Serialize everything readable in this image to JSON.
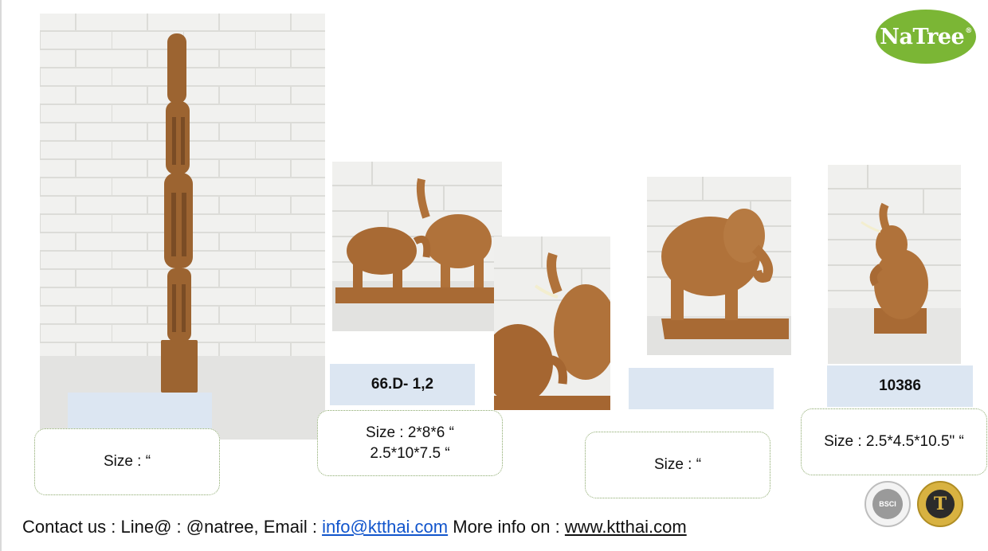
{
  "logo": {
    "text": "NaTree",
    "mark": "®"
  },
  "products": [
    {
      "code": "",
      "size": "Size : “"
    },
    {
      "code": "66.D- 1,2",
      "size_line1": "Size : 2*8*6 “",
      "size_line2": "2.5*10*7.5 “"
    },
    {
      "code": "",
      "size": "Size : “"
    },
    {
      "code": "10386",
      "size": "Size : 2.5*4.5*10.5\" “"
    }
  ],
  "badges": {
    "bsci": "BSCI",
    "trust": "T"
  },
  "footer": {
    "prefix": "Contact us : Line@ : @natree, Email : ",
    "email": "info@ktthai.com",
    "middle": " More info on : ",
    "website": "www.ktthai.com"
  }
}
